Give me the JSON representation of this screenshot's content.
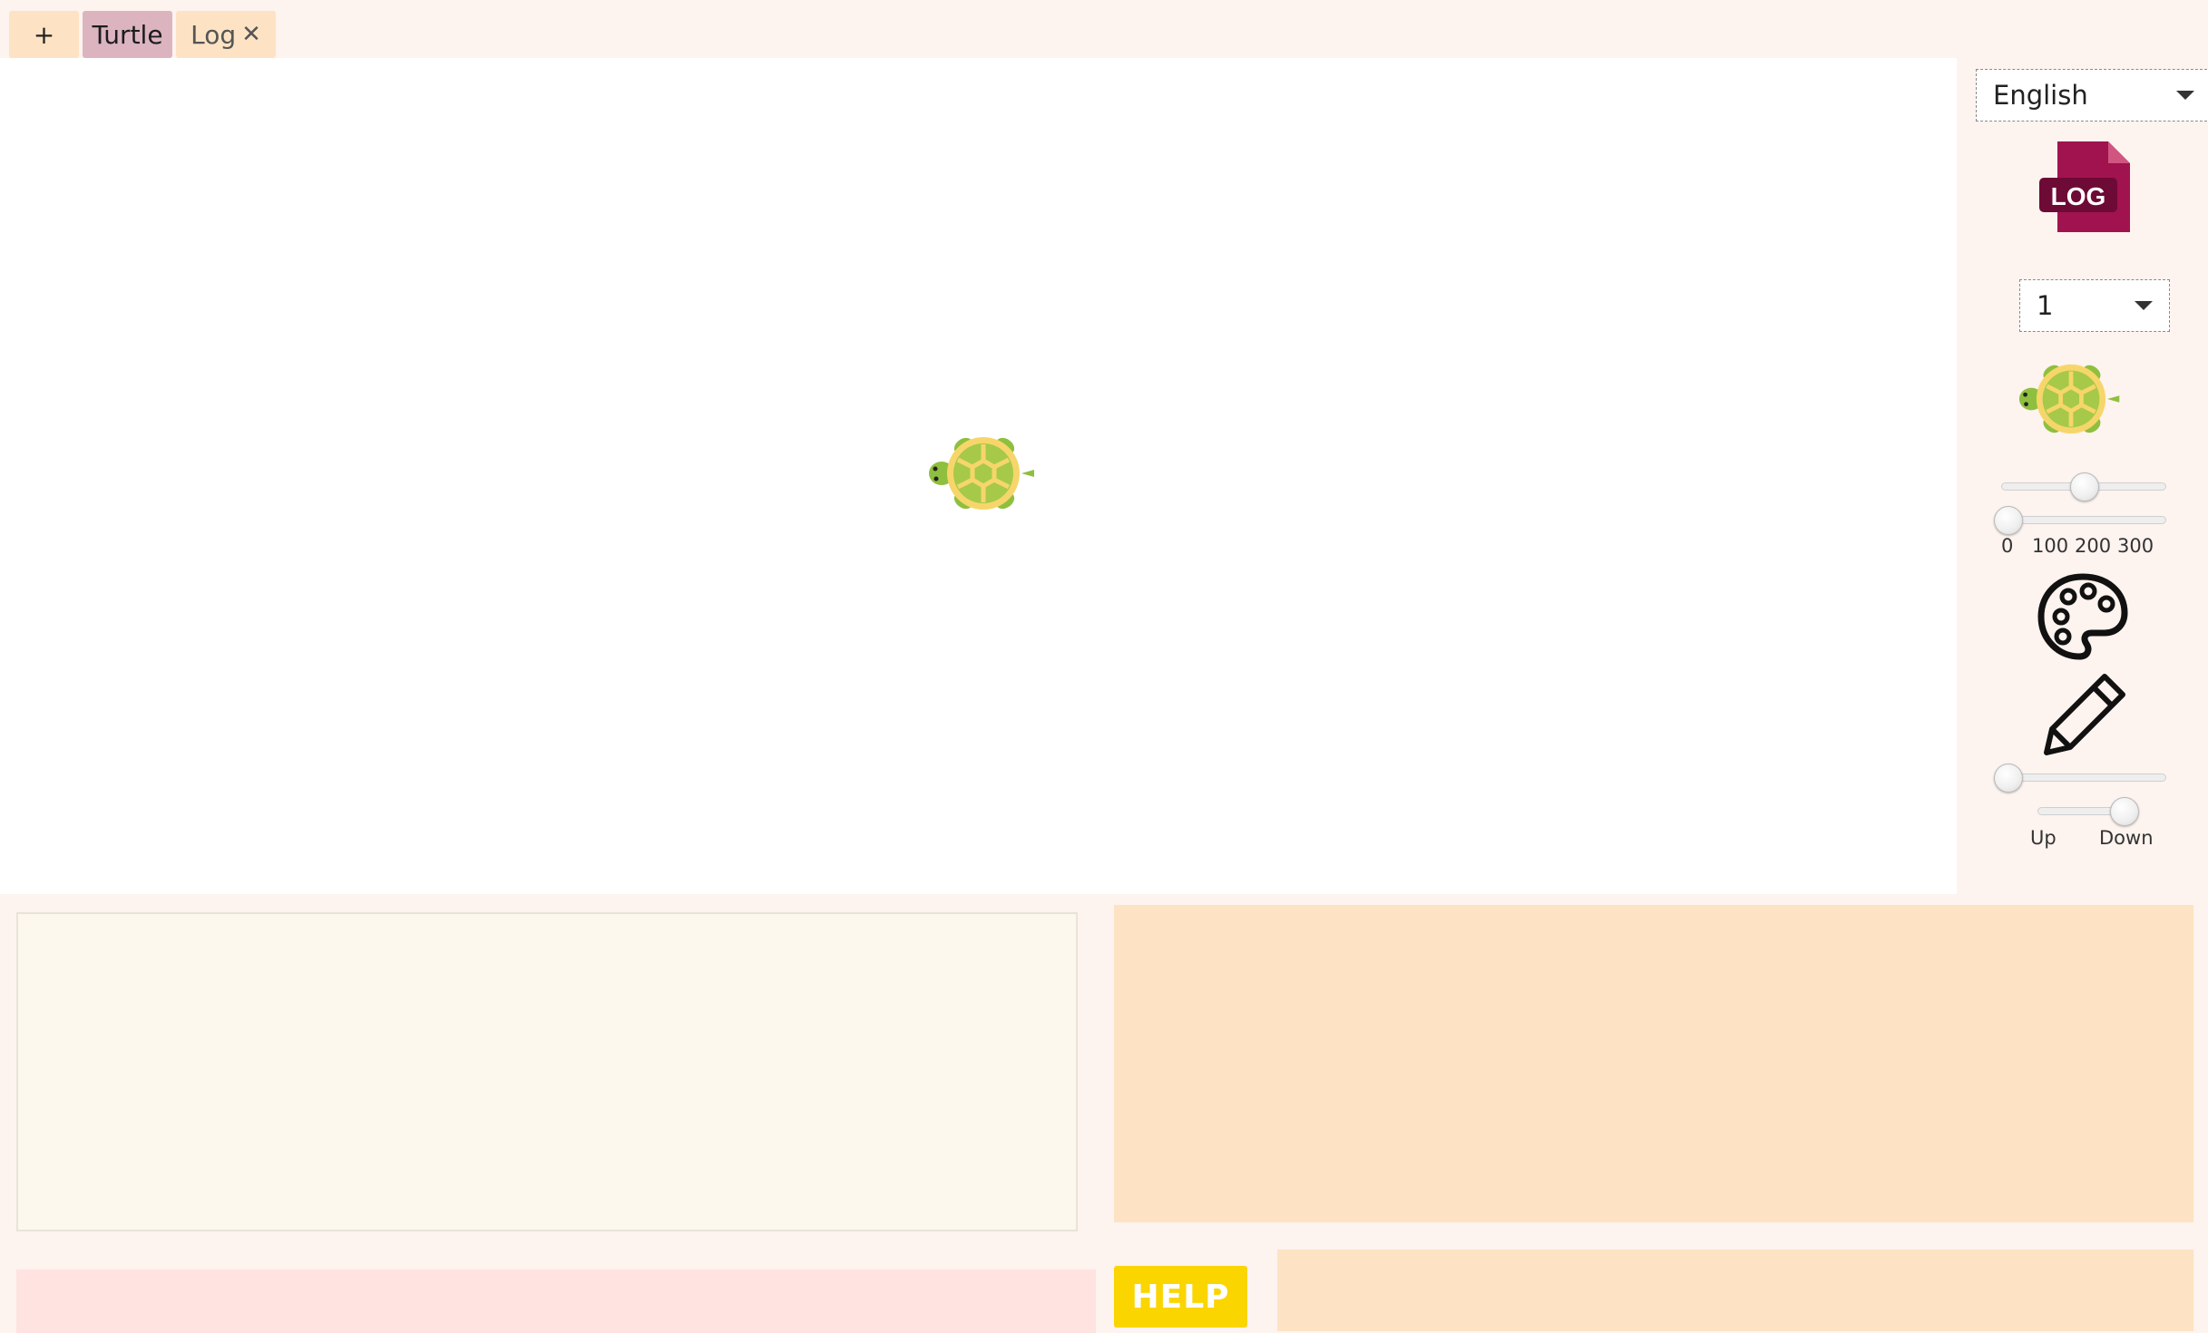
{
  "tabs": {
    "add_label": "+",
    "turtle_label": "Turtle",
    "log_label": "Log",
    "log_close": "✕"
  },
  "sidebar": {
    "language": "English",
    "log_icon_text": "LOG",
    "turtle_select": "1",
    "speed_ticks": [
      "0",
      "100",
      "200",
      "300"
    ],
    "speed_value": 0.5,
    "delay_value": 0,
    "pen_width_value": 0,
    "pen_up_label": "Up",
    "pen_down_label": "Down",
    "pen_state": "Down"
  },
  "help": {
    "label": "HELP"
  },
  "colors": {
    "background": "#fdf3ef",
    "tab": "#fde3c4",
    "tab_active": "#dcb4c0",
    "log_icon": "#a0134f",
    "help": "#fbd500",
    "panel": "#fde3c4",
    "output": "#ffe3e0"
  }
}
